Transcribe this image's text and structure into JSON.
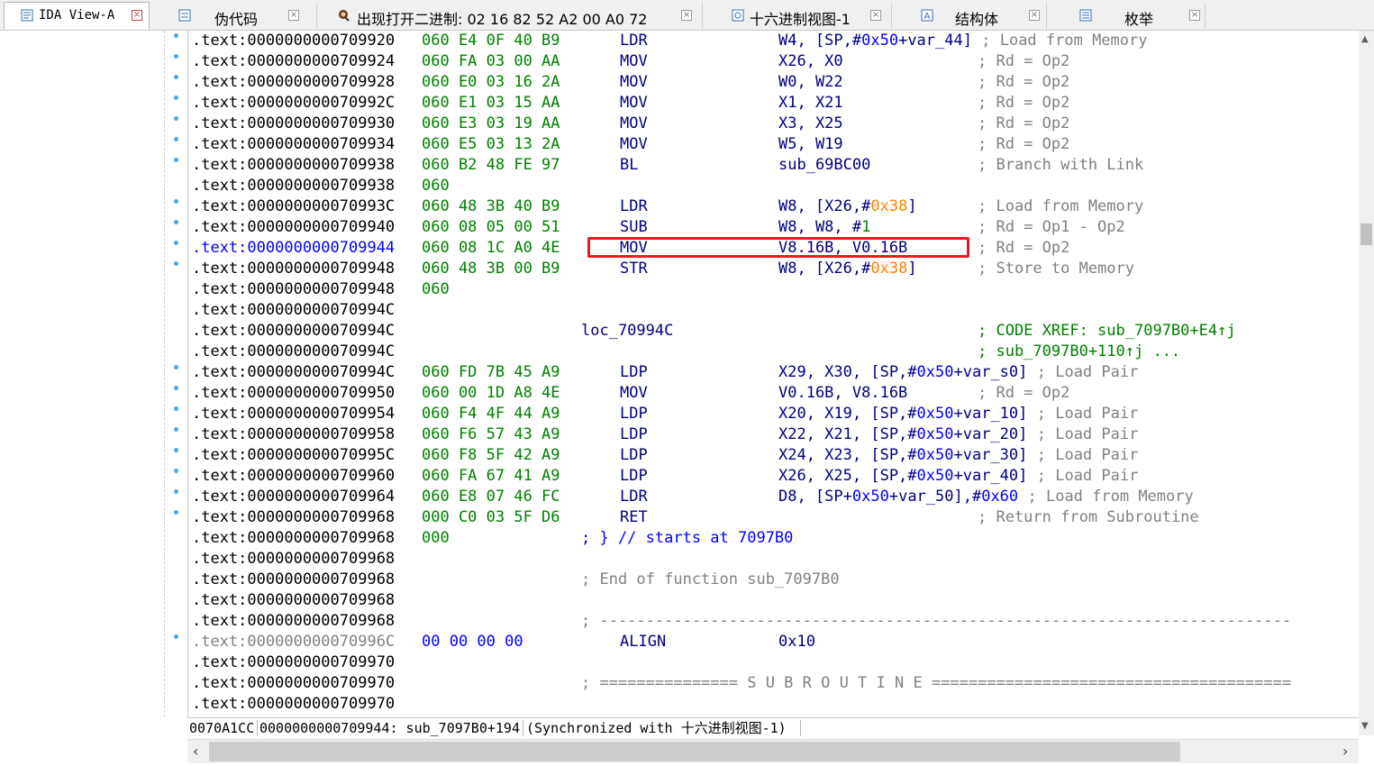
{
  "tabs": [
    {
      "label": "IDA View-A",
      "icon": "ida-view-icon",
      "active": true
    },
    {
      "label": "伪代码",
      "icon": "pseudocode-icon",
      "active": false
    },
    {
      "label": "出现打开二进制: 02 16 82 52 A2 00 A0 72",
      "icon": "search-result-icon",
      "active": false
    },
    {
      "label": "十六进制视图-1",
      "icon": "hex-view-icon",
      "active": false
    },
    {
      "label": "结构体",
      "icon": "structures-icon",
      "active": false
    },
    {
      "label": "枚举",
      "icon": "enums-icon",
      "active": false
    }
  ],
  "listing": [
    {
      "addr": ".text:0000000000709920",
      "bytes": "060 E4 0F 40 B9",
      "mn": "LDR",
      "ops": [
        [
          "W4, [SP,#",
          ""
        ],
        [
          "0x50",
          "blue"
        ],
        [
          "+var_44]",
          ""
        ]
      ],
      "cmt": "; Load from Memory",
      "dot": true
    },
    {
      "addr": ".text:0000000000709924",
      "bytes": "060 FA 03 00 AA",
      "mn": "MOV",
      "ops": [
        [
          "X26, X0",
          ""
        ]
      ],
      "cmt": "; Rd = Op2",
      "dot": true
    },
    {
      "addr": ".text:0000000000709928",
      "bytes": "060 E0 03 16 2A",
      "mn": "MOV",
      "ops": [
        [
          "W0, W22",
          ""
        ]
      ],
      "cmt": "; Rd = Op2",
      "dot": true
    },
    {
      "addr": ".text:000000000070992C",
      "bytes": "060 E1 03 15 AA",
      "mn": "MOV",
      "ops": [
        [
          "X1, X21",
          ""
        ]
      ],
      "cmt": "; Rd = Op2",
      "dot": true
    },
    {
      "addr": ".text:0000000000709930",
      "bytes": "060 E3 03 19 AA",
      "mn": "MOV",
      "ops": [
        [
          "X3, X25",
          ""
        ]
      ],
      "cmt": "; Rd = Op2",
      "dot": true
    },
    {
      "addr": ".text:0000000000709934",
      "bytes": "060 E5 03 13 2A",
      "mn": "MOV",
      "ops": [
        [
          "W5, W19",
          ""
        ]
      ],
      "cmt": "; Rd = Op2",
      "dot": true
    },
    {
      "addr": ".text:0000000000709938",
      "bytes": "060 B2 48 FE 97",
      "mn": "BL",
      "ops": [
        [
          "sub_69BC00",
          ""
        ]
      ],
      "cmt": "; Branch with Link",
      "dot": true
    },
    {
      "addr": ".text:0000000000709938",
      "bytes": "060",
      "mn": "",
      "ops": [],
      "cmt": "",
      "dot": false
    },
    {
      "addr": ".text:000000000070993C",
      "bytes": "060 48 3B 40 B9",
      "mn": "LDR",
      "ops": [
        [
          "W8, [X26,#",
          ""
        ],
        [
          "0x38",
          "orange"
        ],
        [
          "]",
          ""
        ]
      ],
      "cmt": "; Load from Memory",
      "dot": true
    },
    {
      "addr": ".text:0000000000709940",
      "bytes": "060 08 05 00 51",
      "mn": "SUB",
      "ops": [
        [
          "W8, W8, #",
          ""
        ],
        [
          "1",
          "green"
        ]
      ],
      "cmt": "; Rd = Op1 - Op2",
      "dot": true
    },
    {
      "addr": ".text:0000000000709944",
      "bytes": "060 08 1C A0 4E",
      "mn": "MOV",
      "ops": [
        [
          "V8.16B, V0.16B",
          ""
        ]
      ],
      "cmt": "; Rd = Op2",
      "dot": true,
      "hl": true
    },
    {
      "addr": ".text:0000000000709948",
      "bytes": "060 48 3B 00 B9",
      "mn": "STR",
      "ops": [
        [
          "W8, [X26,#",
          ""
        ],
        [
          "0x38",
          "orange"
        ],
        [
          "]",
          ""
        ]
      ],
      "cmt": "; Store to Memory",
      "dot": true
    },
    {
      "addr": ".text:0000000000709948",
      "bytes": "060",
      "mn": "",
      "ops": [],
      "cmt": "",
      "dot": false
    },
    {
      "addr": ".text:000000000070994C",
      "bytes": "",
      "mn": "",
      "ops": [],
      "cmt": "",
      "dot": false
    },
    {
      "addr": ".text:000000000070994C",
      "bytes": "",
      "loc": "loc_70994C",
      "mn": "",
      "ops": [],
      "xref": "; CODE XREF: sub_7097B0+E4↑j",
      "dot": false
    },
    {
      "addr": ".text:000000000070994C",
      "bytes": "",
      "mn": "",
      "ops": [],
      "xref": "; sub_7097B0+110↑j ...",
      "dot": false
    },
    {
      "addr": ".text:000000000070994C",
      "bytes": "060 FD 7B 45 A9",
      "mn": "LDP",
      "ops": [
        [
          "X29, X30, [SP,#",
          ""
        ],
        [
          "0x50",
          "blue"
        ],
        [
          "+var_s0]",
          ""
        ]
      ],
      "cmt": "; Load Pair",
      "dot": true
    },
    {
      "addr": ".text:0000000000709950",
      "bytes": "060 00 1D A8 4E",
      "mn": "MOV",
      "ops": [
        [
          "V0.16B, V8.16B",
          ""
        ]
      ],
      "cmt": "; Rd = Op2",
      "dot": true
    },
    {
      "addr": ".text:0000000000709954",
      "bytes": "060 F4 4F 44 A9",
      "mn": "LDP",
      "ops": [
        [
          "X20, X19, [SP,#",
          ""
        ],
        [
          "0x50",
          "blue"
        ],
        [
          "+var_10]",
          ""
        ]
      ],
      "cmt": "; Load Pair",
      "dot": true
    },
    {
      "addr": ".text:0000000000709958",
      "bytes": "060 F6 57 43 A9",
      "mn": "LDP",
      "ops": [
        [
          "X22, X21, [SP,#",
          ""
        ],
        [
          "0x50",
          "blue"
        ],
        [
          "+var_20]",
          ""
        ]
      ],
      "cmt": "; Load Pair",
      "dot": true
    },
    {
      "addr": ".text:000000000070995C",
      "bytes": "060 F8 5F 42 A9",
      "mn": "LDP",
      "ops": [
        [
          "X24, X23, [SP,#",
          ""
        ],
        [
          "0x50",
          "blue"
        ],
        [
          "+var_30]",
          ""
        ]
      ],
      "cmt": "; Load Pair",
      "dot": true
    },
    {
      "addr": ".text:0000000000709960",
      "bytes": "060 FA 67 41 A9",
      "mn": "LDP",
      "ops": [
        [
          "X26, X25, [SP,#",
          ""
        ],
        [
          "0x50",
          "blue"
        ],
        [
          "+var_40]",
          ""
        ]
      ],
      "cmt": "; Load Pair",
      "dot": true
    },
    {
      "addr": ".text:0000000000709964",
      "bytes": "060 E8 07 46 FC",
      "mn": "LDR",
      "ops": [
        [
          "D8, [SP+",
          ""
        ],
        [
          "0x50",
          "blue"
        ],
        [
          "+var_50],#",
          ""
        ],
        [
          "0x60",
          "blue"
        ]
      ],
      "cmt": "; Load from Memory",
      "dot": true
    },
    {
      "addr": ".text:0000000000709968",
      "bytes": "000 C0 03 5F D6",
      "mn": "RET",
      "ops": [],
      "cmt": "; Return from Subroutine",
      "dot": true
    },
    {
      "addr": ".text:0000000000709968",
      "bytes": "000",
      "mn": "",
      "ops": [],
      "blue": "; } // starts at 7097B0",
      "dot": false
    },
    {
      "addr": ".text:0000000000709968",
      "bytes": "",
      "mn": "",
      "ops": [],
      "dot": false
    },
    {
      "addr": ".text:0000000000709968",
      "bytes": "",
      "mn": "",
      "ops": [],
      "gray": "; End of function sub_7097B0",
      "dot": false
    },
    {
      "addr": ".text:0000000000709968",
      "bytes": "",
      "mn": "",
      "ops": [],
      "dot": false
    },
    {
      "addr": ".text:0000000000709968",
      "bytes": "",
      "mn": "",
      "ops": [],
      "gray": "; ---------------------------------------------------------------------------",
      "dot": false
    },
    {
      "addr": ".text:000000000070996C",
      "bytes": "00 00 00 00",
      "mn": "ALIGN",
      "ops": [
        [
          "0x10",
          ""
        ]
      ],
      "dot": true,
      "grayaddr": true,
      "bluebytes": true
    },
    {
      "addr": ".text:0000000000709970",
      "bytes": "",
      "mn": "",
      "ops": [],
      "dot": false
    },
    {
      "addr": ".text:0000000000709970",
      "bytes": "",
      "mn": "",
      "ops": [],
      "gray": "; =============== S U B R O U T I N E =======================================",
      "dot": false
    },
    {
      "addr": ".text:0000000000709970",
      "bytes": "",
      "mn": "",
      "ops": [],
      "dot": false
    }
  ],
  "status": {
    "offset": "0070A1CC",
    "location": "0000000000709944: sub_7097B0+194",
    "sync": "(Synchronized with 十六进制视图-1)"
  },
  "colors": {
    "highlight_box": "#e81c1c",
    "address": "#000000",
    "bytes": "#008000",
    "mnemonic": "#000080",
    "comment": "#808080",
    "number_blue": "#0000ff",
    "number_orange": "#ff8000",
    "number_green": "#008000"
  }
}
